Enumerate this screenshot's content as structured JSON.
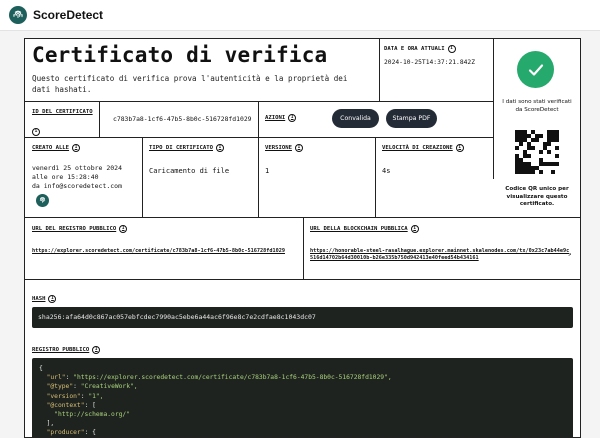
{
  "app": {
    "brand": "ScoreDetect"
  },
  "certificate": {
    "title": "Certificato di verifica",
    "description": "Questo certificato di verifica prova l'autenticità e la proprietà dei dati hashati.",
    "current_date_label": "DATA E ORA ATTUALI",
    "current_date": "2024-10-25T14:37:21.842Z",
    "certificate_id_label": "ID DEL CERTIFICATO",
    "certificate_id": "c783b7a8-1cf6-47b5-8b0c-516728fd1029",
    "actions_label": "AZIONI",
    "validate_button": "Convalida",
    "print_button": "Stampa PDF",
    "created_label": "CREATO ALLE",
    "created_value": "venerdì 25 ottobre 2024 alle ore 15:28:40",
    "created_by": "da info@scoredetect.com",
    "type_label": "TIPO DI CERTIFICATO",
    "type_value": "Caricamento di file",
    "version_label": "VERSIONE",
    "version_value": "1",
    "speed_label": "VELOCITÀ DI CREAZIONE",
    "speed_value": "4s",
    "public_registry_url_label": "URL DEL REGISTRO PUBBLICO",
    "public_registry_url": "https://explorer.scoredetect.com/certificate/c783b7a8-1cf6-47b5-8b0c-516728fd1029",
    "blockchain_url_label": "URL DELLA BLOCKCHAIN PUBBLICA",
    "blockchain_url": "https://honorable-steel-rasalhague.explorer.mainnet.skalenodes.com/tx/0x23c7ab44e9c516d14702b64d30010b-b26e335b750d942413e40feed54b434161",
    "hash_label": "HASH",
    "hash_value": "sha256:afa64d0c867ac057ebfcdec7990ac5ebe6a44ac6f96e8c7e2cdfae8c1043dc07",
    "registry_label": "REGISTRO PUBBLICO"
  },
  "registry_json": {
    "brace_open": "{",
    "url_key": "\"url\"",
    "url_value": "\"https://explorer.scoredetect.com/certificate/c783b7a8-1cf6-47b5-8b0c-516728fd1029\",",
    "type_key": "\"@type\"",
    "type_value": "\"CreativeWork\",",
    "version_key": "\"version\"",
    "version_value": "\"1\",",
    "context_key": "\"@context\"",
    "context_open": "[",
    "context_value": "\"http://schema.org/\"",
    "context_close": "],",
    "producer_key": "\"producer\"",
    "producer_open": "{"
  },
  "sidebar": {
    "verified_text": "I dati sono stati verificati da ScoreDetect",
    "qr_text": "Codice QR unico per visualizzare questo certificato."
  },
  "colors": {
    "check": "#26a96c",
    "button": "#232b36",
    "code_bg": "#1f2320",
    "logo": "#1d5f5b"
  }
}
